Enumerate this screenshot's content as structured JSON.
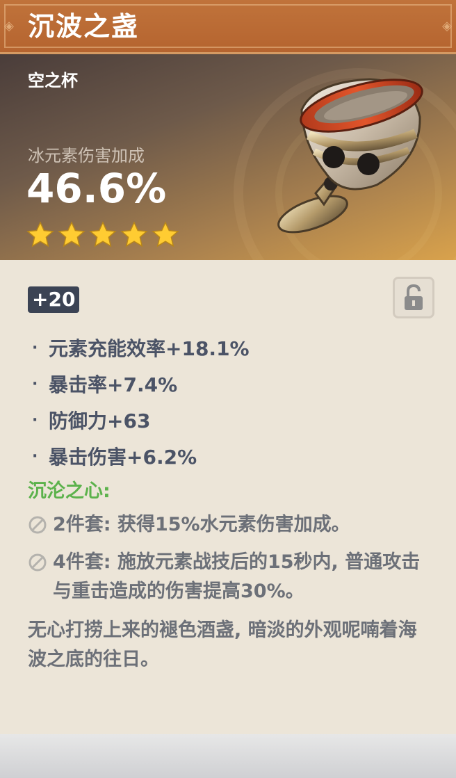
{
  "artifact": {
    "name": "沉波之盏",
    "type": "空之杯",
    "main_stat": {
      "name": "冰元素伤害加成",
      "value": "46.6%"
    },
    "rarity_stars": 5,
    "level": "+20",
    "locked": false,
    "substats": [
      {
        "bullet": "·",
        "text": "元素充能效率+18.1%"
      },
      {
        "bullet": "·",
        "text": "暴击率+7.4%"
      },
      {
        "bullet": "·",
        "text": "防御力+63"
      },
      {
        "bullet": "·",
        "text": "暴击伤害+6.2%"
      }
    ],
    "set": {
      "name": "沉沦之心:",
      "bonuses": [
        {
          "text": "2件套: 获得15%水元素伤害加成。"
        },
        {
          "text": "4件套: 施放元素战技后的15秒内, 普通攻击与重击造成的伤害提高30%。"
        }
      ]
    },
    "description": "无心打捞上来的褪色酒盏, 暗淡的外观呢喃着海波之底的往日。"
  },
  "icons": {
    "star": "star-icon",
    "lock": "unlock-icon",
    "inactive": "prohibited-icon",
    "artifact": "goblet-icon"
  },
  "colors": {
    "title_bar": "#b5642f",
    "star": "#ffcc32",
    "set_name": "#5cb24c",
    "level_badge": "#3b4354",
    "body_bg": "#ece5d8"
  }
}
